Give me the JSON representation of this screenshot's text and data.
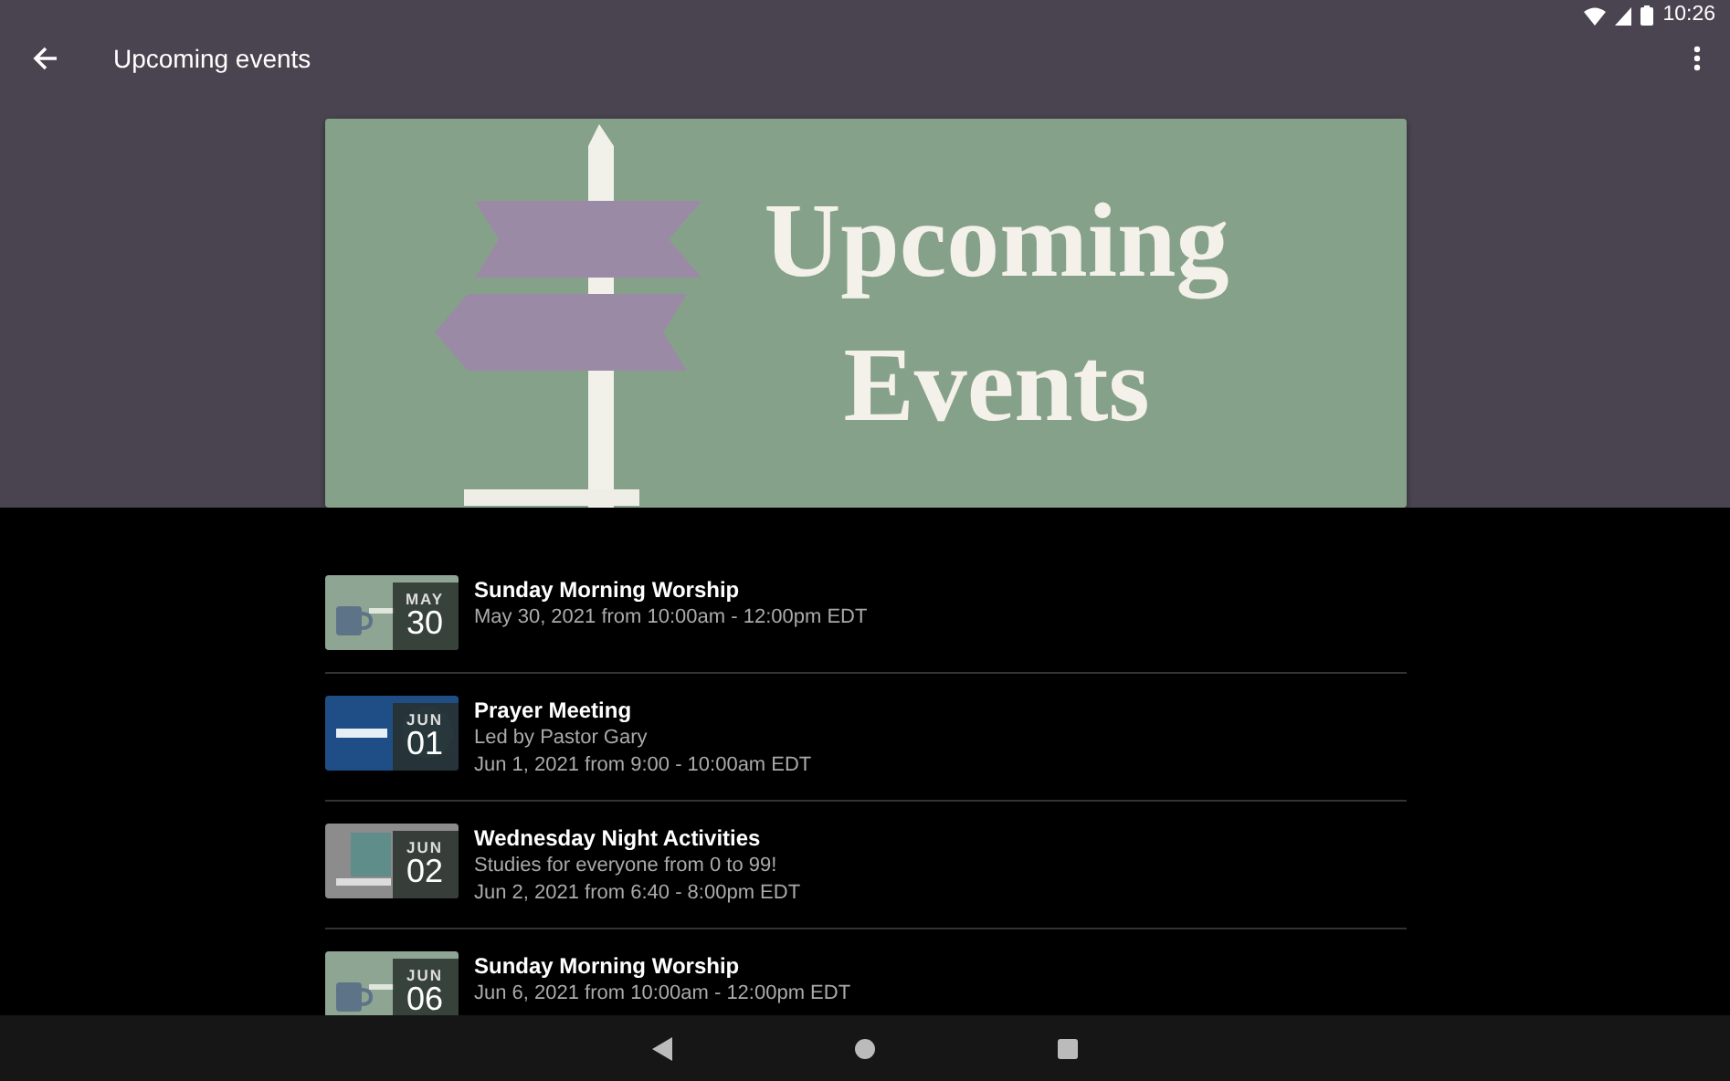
{
  "status_bar": {
    "time": "10:26"
  },
  "app_bar": {
    "title": "Upcoming events"
  },
  "banner": {
    "title": "Upcoming Events"
  },
  "events": [
    {
      "title": "Sunday Morning Worship",
      "month": "MAY",
      "day": "30",
      "lines": [
        "May 30, 2021 from 10:00am - 12:00pm EDT"
      ]
    },
    {
      "title": "Prayer Meeting",
      "month": "JUN",
      "day": "01",
      "lines": [
        "Led by Pastor Gary",
        "Jun 1, 2021 from 9:00 - 10:00am EDT"
      ]
    },
    {
      "title": "Wednesday Night Activities",
      "month": "JUN",
      "day": "02",
      "lines": [
        "Studies for everyone from 0 to 99!",
        "Jun 2, 2021 from 6:40 - 8:00pm EDT"
      ]
    },
    {
      "title": "Sunday Morning Worship",
      "month": "JUN",
      "day": "06",
      "lines": [
        "Jun 6, 2021 from 10:00am - 12:00pm EDT"
      ]
    }
  ]
}
